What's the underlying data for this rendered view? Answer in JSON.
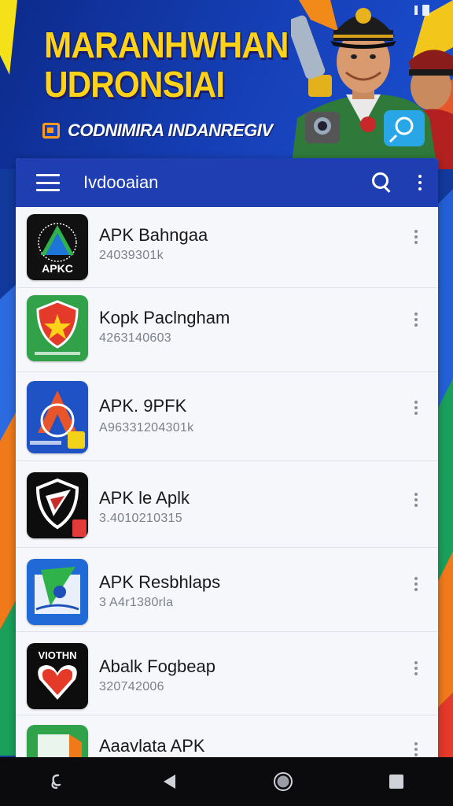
{
  "banner": {
    "title_line1": "MARANHWHAN",
    "title_line2": "UDRONSIAI",
    "subtitle": "CODNIMIRA INDANREGIV",
    "subtitle_icon": "tv-icon"
  },
  "appbar": {
    "title": "Ivdooaian",
    "menu_icon": "menu-icon",
    "search_icon": "search-icon",
    "more_icon": "more-vert-icon"
  },
  "apps": [
    {
      "name": "APK Bahngaa",
      "meta": "24039301k",
      "icon": "apk-triangle-logo",
      "icon_text": "APKC"
    },
    {
      "name": "Kopk Paclngham",
      "meta": "4263140603",
      "icon": "red-shield-star-logo",
      "icon_text": ""
    },
    {
      "name": "APK. 9PFK",
      "meta": "A96331204301k",
      "icon": "blue-arrow-logo",
      "icon_text": ""
    },
    {
      "name": "APK le Aplk",
      "meta": "3.4010210315",
      "icon": "black-shield-logo",
      "icon_text": ""
    },
    {
      "name": "APK Resbhlaps",
      "meta": "3 A4r1380rla",
      "icon": "blue-book-logo",
      "icon_text": ""
    },
    {
      "name": "Abalk Fogbeap",
      "meta": "320742006",
      "icon": "heart-logo",
      "icon_text": "VIOTHN"
    },
    {
      "name": "Aaavlata APK",
      "meta": "",
      "icon": "green-app-logo",
      "icon_text": ""
    }
  ],
  "navbar": {
    "items": [
      "assist-icon",
      "back-icon",
      "home-icon",
      "recents-icon"
    ]
  },
  "colors": {
    "appbar": "#1f3eb2",
    "banner_title": "#ffd21a",
    "list_bg": "#f6f7fb"
  }
}
